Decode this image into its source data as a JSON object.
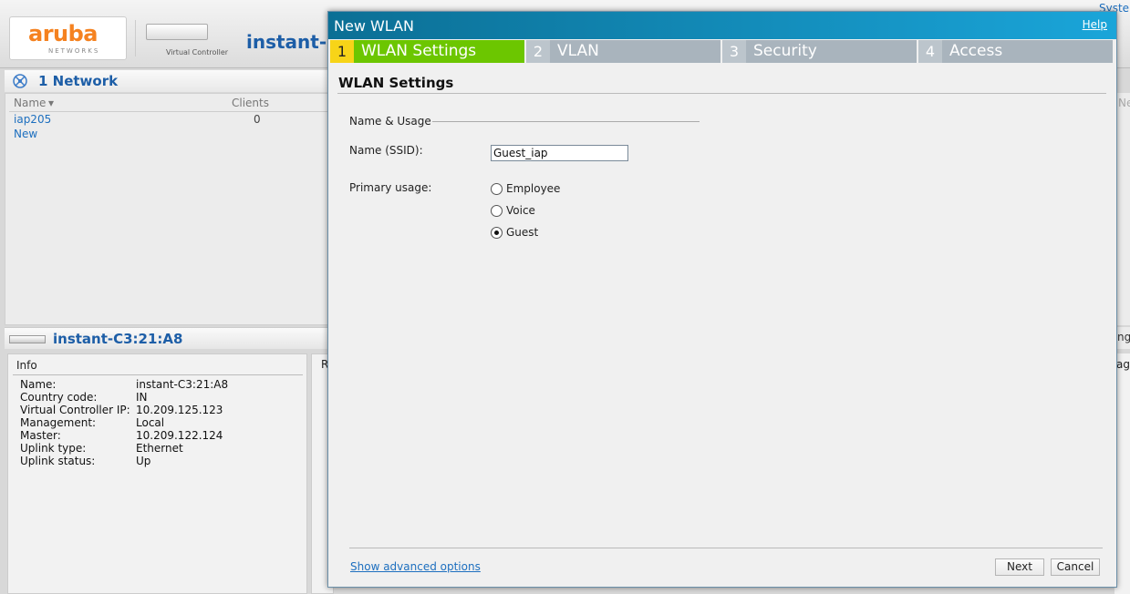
{
  "app": {
    "logo_text": "aruba",
    "logo_sub": "NETWORKS",
    "vc_label": "Virtual Controller",
    "title": "instant-C",
    "top_right_link": "Syste"
  },
  "networks": {
    "title": "1 Network",
    "columns": [
      "Name",
      "Clients"
    ],
    "rows": [
      {
        "name": "iap205",
        "clients": "0"
      },
      {
        "name": "New",
        "clients": ""
      }
    ],
    "right_strip_text": "Ne"
  },
  "device": {
    "title": "instant-C3:21:A8",
    "right_strip_text": "ng"
  },
  "info": {
    "title": "Info",
    "rows": [
      {
        "label": "Name:",
        "value": "instant-C3:21:A8"
      },
      {
        "label": "Country code:",
        "value": "IN"
      },
      {
        "label": "Virtual Controller IP:",
        "value": "10.209.125.123"
      },
      {
        "label": "Management:",
        "value": "Local"
      },
      {
        "label": "Master:",
        "value": "10.209.122.124"
      },
      {
        "label": "Uplink type:",
        "value": "Ethernet"
      },
      {
        "label": "Uplink status:",
        "value": "Up"
      }
    ],
    "panel2_text": "R",
    "right_strip_text": "age"
  },
  "modal": {
    "title": "New WLAN",
    "help": "Help",
    "steps": [
      {
        "num": "1",
        "label": "WLAN Settings",
        "active": true
      },
      {
        "num": "2",
        "label": "VLAN",
        "active": false
      },
      {
        "num": "3",
        "label": "Security",
        "active": false
      },
      {
        "num": "4",
        "label": "Access",
        "active": false
      }
    ],
    "section_title": "WLAN Settings",
    "fieldset_legend": "Name & Usage",
    "ssid_label": "Name (SSID):",
    "ssid_value": "Guest_iap",
    "usage_label": "Primary usage:",
    "usage_options": [
      {
        "label": "Employee",
        "checked": false
      },
      {
        "label": "Voice",
        "checked": false
      },
      {
        "label": "Guest",
        "checked": true
      }
    ],
    "advanced_link": "Show advanced options",
    "next_label": "Next",
    "cancel_label": "Cancel"
  }
}
